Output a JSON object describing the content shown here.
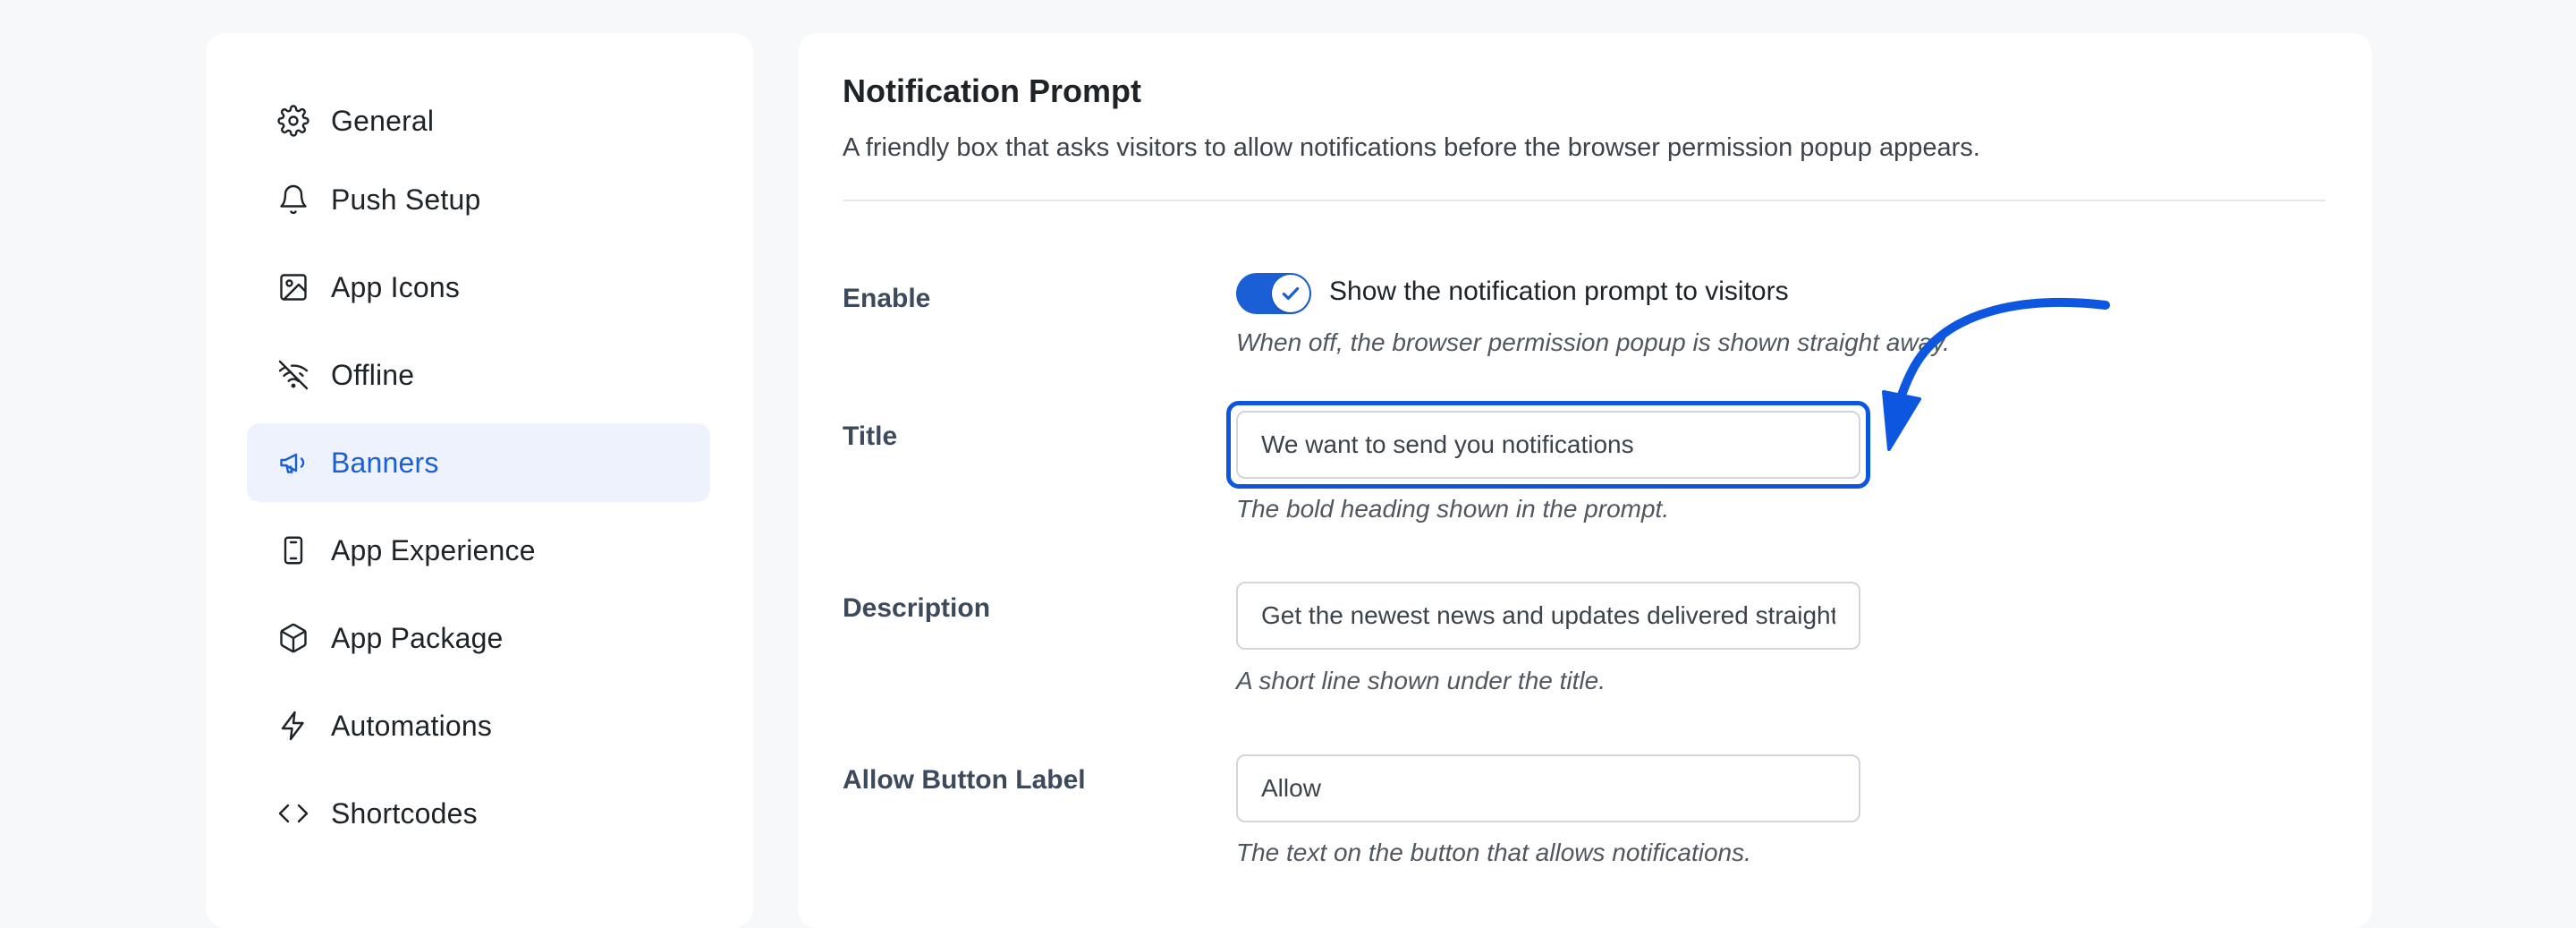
{
  "sidebar": {
    "items": [
      {
        "label": "General",
        "icon": "gear-icon"
      },
      {
        "label": "Push Setup",
        "icon": "bell-icon"
      },
      {
        "label": "App Icons",
        "icon": "image-icon"
      },
      {
        "label": "Offline",
        "icon": "wifi-off-icon"
      },
      {
        "label": "Banners",
        "icon": "megaphone-icon",
        "active": true
      },
      {
        "label": "App Experience",
        "icon": "phone-icon"
      },
      {
        "label": "App Package",
        "icon": "package-icon"
      },
      {
        "label": "Automations",
        "icon": "lightning-icon"
      },
      {
        "label": "Shortcodes",
        "icon": "code-icon"
      }
    ]
  },
  "main": {
    "title": "Notification Prompt",
    "description": "A friendly box that asks visitors to allow notifications before the browser permission popup appears.",
    "fields": {
      "enable": {
        "label": "Enable",
        "toggle_on": true,
        "toggle_label": "Show the notification prompt to visitors",
        "help": "When off, the browser permission popup is shown straight away."
      },
      "title": {
        "label": "Title",
        "value": "We want to send you notifications",
        "help": "The bold heading shown in the prompt."
      },
      "description": {
        "label": "Description",
        "value": "Get the newest news and updates delivered straight to you",
        "help": "A short line shown under the title."
      },
      "allow_button": {
        "label": "Allow Button Label",
        "value": "Allow",
        "help": "The text on the button that allows notifications."
      }
    }
  },
  "colors": {
    "accent": "#1a5fd6",
    "highlight": "#0d57e0",
    "active_bg": "#eef2fd"
  }
}
